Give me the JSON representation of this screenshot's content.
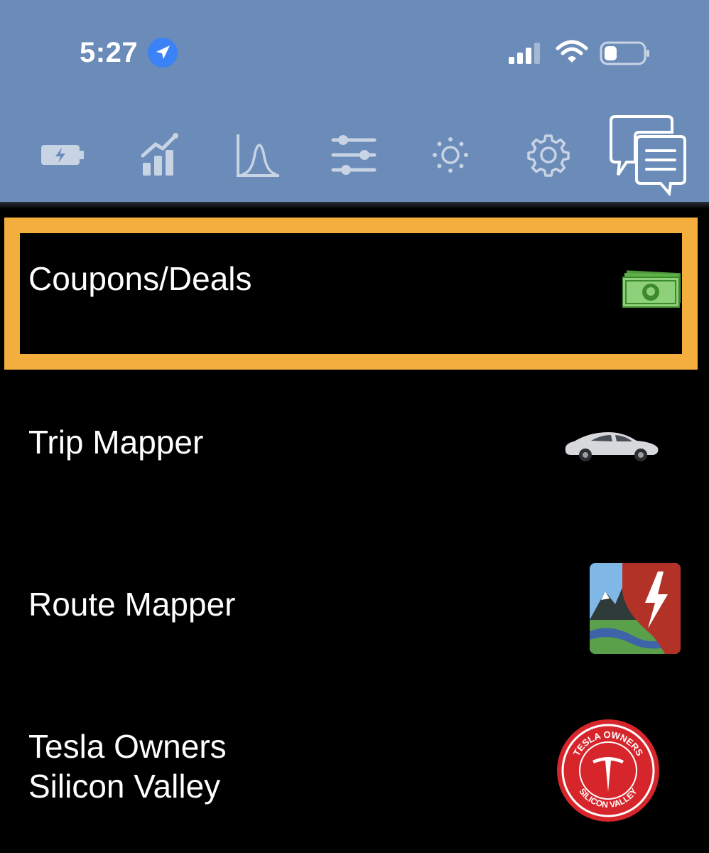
{
  "status_bar": {
    "time": "5:27"
  },
  "toolbar": {
    "tabs": [
      "battery-icon",
      "bar-chart-icon",
      "curve-chart-icon",
      "sliders-icon",
      "brightness-icon",
      "gear-icon",
      "chat-icon"
    ]
  },
  "menu": {
    "items": [
      {
        "label": "Coupons/Deals",
        "icon": "money-icon"
      },
      {
        "label": "Trip Mapper",
        "icon": "car-icon"
      },
      {
        "label": "Route Mapper",
        "icon": "route-mapper-app-icon"
      },
      {
        "label": "Tesla Owners\nSilicon Valley",
        "icon": "tesla-owners-logo"
      }
    ]
  },
  "logos": {
    "tesla_owners_top": "TESLA OWNERS",
    "tesla_owners_bottom": "SILICON VALLEY"
  },
  "colors": {
    "topbar": "#6b8bb8",
    "highlight": "#f4ae3e",
    "background": "#000000"
  }
}
